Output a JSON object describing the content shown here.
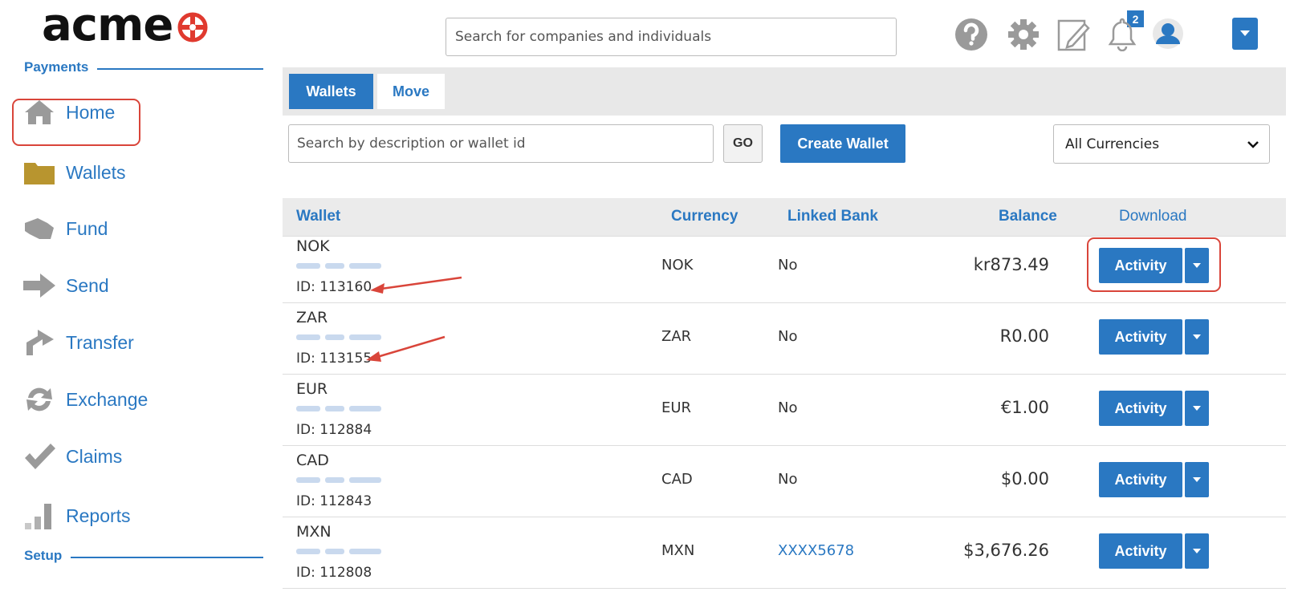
{
  "brand": {
    "name": "acme"
  },
  "header": {
    "search_placeholder": "Search for companies and individuals",
    "notes_badge": "2"
  },
  "colors": {
    "accent": "#2a78c2",
    "highlight": "#d9453a",
    "folder": "#b8952f",
    "icon_gray": "#9a9a9a"
  },
  "sidebar": {
    "section_payments": "Payments",
    "section_setup": "Setup",
    "items": [
      {
        "label": "Home",
        "icon": "home-icon"
      },
      {
        "label": "Wallets",
        "icon": "folder-icon",
        "active": true
      },
      {
        "label": "Fund",
        "icon": "fund-icon"
      },
      {
        "label": "Send",
        "icon": "arrow-right-icon"
      },
      {
        "label": "Transfer",
        "icon": "transfer-icon"
      },
      {
        "label": "Exchange",
        "icon": "exchange-icon"
      },
      {
        "label": "Claims",
        "icon": "checkmark-icon"
      },
      {
        "label": "Reports",
        "icon": "bar-chart-icon"
      }
    ]
  },
  "tabs": [
    {
      "label": "Wallets",
      "active": true
    },
    {
      "label": "Move",
      "active": false
    }
  ],
  "toolbar": {
    "search_placeholder": "Search by description or wallet id",
    "go_label": "GO",
    "create_label": "Create Wallet",
    "currency_selected": "All Currencies"
  },
  "table": {
    "headers": {
      "wallet": "Wallet",
      "currency": "Currency",
      "linked_bank": "Linked Bank",
      "balance": "Balance",
      "download": "Download"
    },
    "action_label": "Activity",
    "rows": [
      {
        "wallet": "NOK",
        "id": "ID: 113160",
        "currency": "NOK",
        "linked_bank": "No",
        "balance": "kr873.49"
      },
      {
        "wallet": "ZAR",
        "id": "ID: 113155",
        "currency": "ZAR",
        "linked_bank": "No",
        "balance": "R0.00"
      },
      {
        "wallet": "EUR",
        "id": "ID: 112884",
        "currency": "EUR",
        "linked_bank": "No",
        "balance": "€1.00"
      },
      {
        "wallet": "CAD",
        "id": "ID: 112843",
        "currency": "CAD",
        "linked_bank": "No",
        "balance": "$0.00"
      },
      {
        "wallet": "MXN",
        "id": "ID: 112808",
        "currency": "MXN",
        "linked_bank": "XXXX5678",
        "balance": "$3,676.26"
      }
    ]
  }
}
